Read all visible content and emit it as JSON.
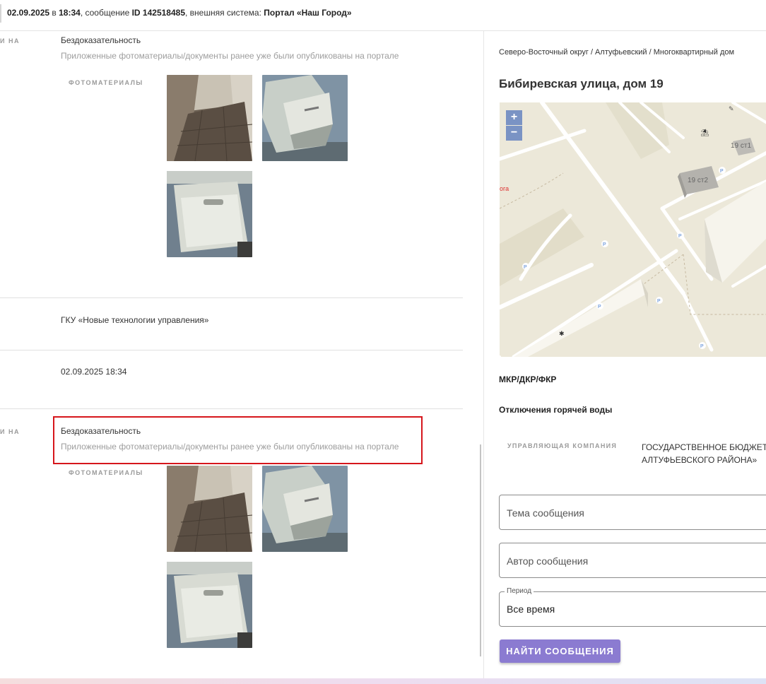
{
  "header": {
    "date": "02.09.2025",
    "in_word": " в ",
    "time": "18:34",
    "message_prefix": ", сообщение ",
    "message_id": "ID 142518485",
    "system_prefix": ", внешняя система: ",
    "system_name": "Портал «Наш Город»"
  },
  "left": {
    "cut_label_1": "И НА",
    "cut_label_2": "И НА",
    "block1": {
      "title": "Бездоказательность",
      "subtitle": "Приложенные фотоматериалы/документы ранее уже были опубликованы на портале",
      "photos_label": "ФОТОМАТЕРИАЛЫ"
    },
    "org": "ГКУ «Новые технологии управления»",
    "datetime": "02.09.2025 18:34",
    "block2": {
      "title": "Бездоказательность",
      "subtitle": "Приложенные фотоматериалы/документы ранее уже были опубликованы на портале",
      "photos_label": "ФОТОМАТЕРИАЛЫ"
    }
  },
  "right": {
    "breadcrumb": "Северо-Восточный округ / Алтуфьевский / Многоквартирный дом",
    "address": "Бибиревская улица, дом 19",
    "map": {
      "zoom_in": "+",
      "zoom_out": "−",
      "building_label_1": "19 ст2",
      "building_label_2": "19 ст1",
      "edge_text": "ога",
      "parking": "P"
    },
    "section_1": "МКР/ДКР/ФКР",
    "section_2": "Отключения горячей воды",
    "management_label": "УПРАВЛЯЮЩАЯ КОМПАНИЯ",
    "management_line1": "ГОСУДАРСТВЕННОЕ БЮДЖЕТН",
    "management_line2": "АЛТУФЬЕВСКОГО РАЙОНА»",
    "topic_placeholder": "Тема сообщения",
    "author_placeholder": "Автор сообщения",
    "period_label": "Период",
    "period_value": "Все время",
    "search_button": "НАЙТИ СООБЩЕНИЯ"
  },
  "colors": {
    "accent_button": "#8b7bd1",
    "highlight_border": "#d6161c",
    "map_background": "#ece8d9",
    "zoom_button": "#7a93c4"
  }
}
